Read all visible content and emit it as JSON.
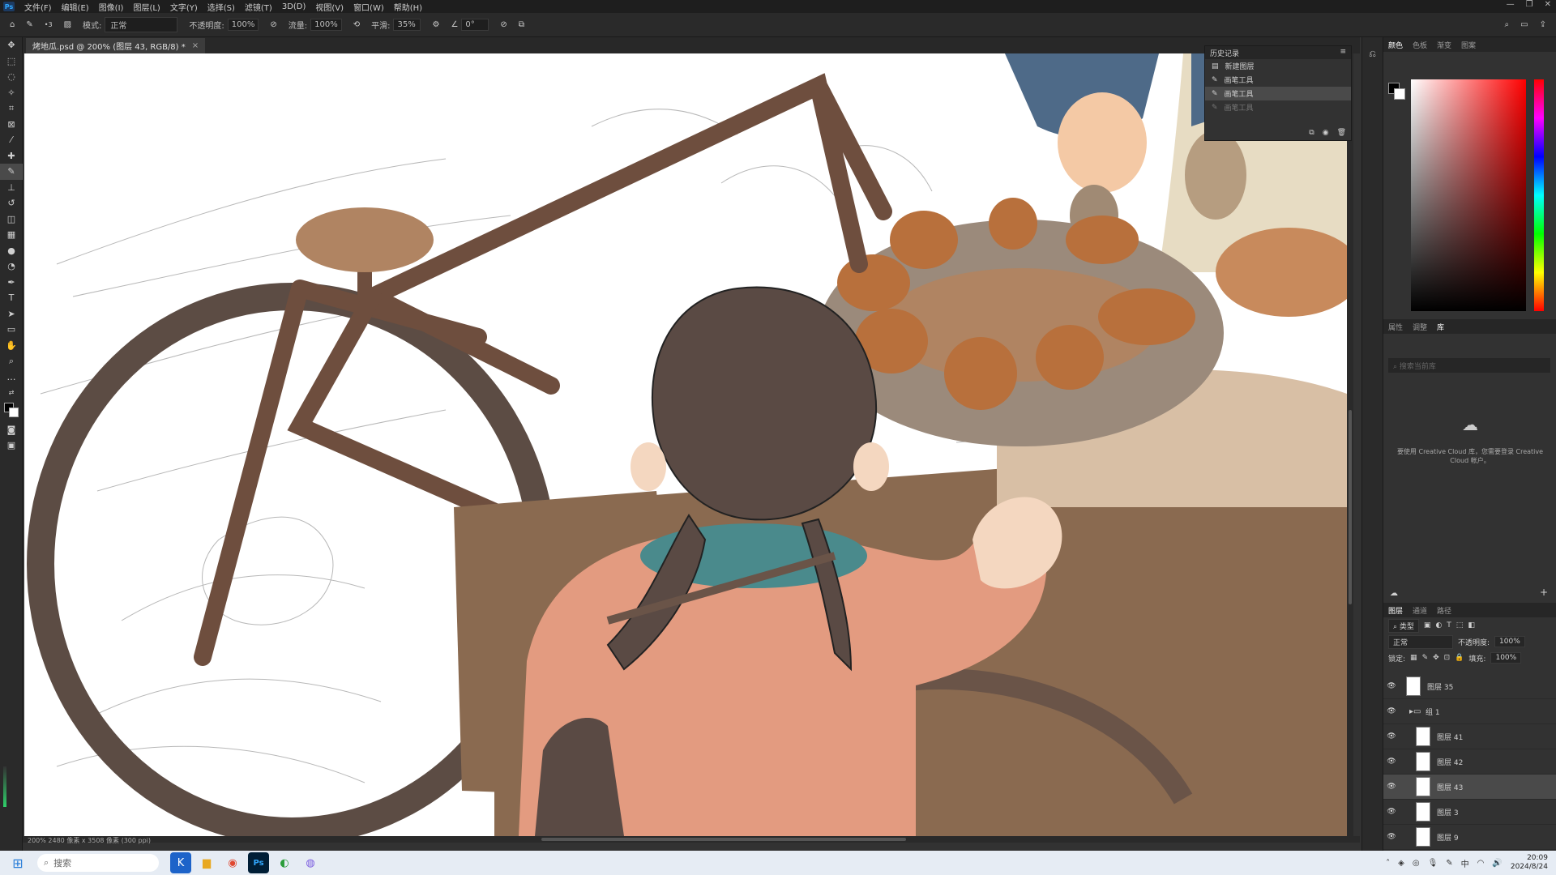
{
  "menubar": {
    "items": [
      "文件(F)",
      "编辑(E)",
      "图像(I)",
      "图层(L)",
      "文字(Y)",
      "选择(S)",
      "滤镜(T)",
      "3D(D)",
      "视图(V)",
      "窗口(W)",
      "帮助(H)"
    ]
  },
  "options": {
    "mode_label": "模式:",
    "mode_value": "正常",
    "opacity_label": "不透明度:",
    "opacity_value": "100%",
    "flow_label": "流量:",
    "flow_value": "100%",
    "smooth_label": "平滑:",
    "smooth_value": "35%",
    "angle_value": "0°",
    "brush_size": "3"
  },
  "document": {
    "tab_title": "烤地瓜.psd @ 200% (图层 43, RGB/8) *",
    "status": "200%   2480 像素 x 3508 像素 (300 ppi)"
  },
  "history": {
    "title": "历史记录",
    "items": [
      {
        "label": "新建图层"
      },
      {
        "label": "画笔工具"
      },
      {
        "label": "画笔工具"
      },
      {
        "label": "画笔工具"
      }
    ]
  },
  "color_panel": {
    "tabs": [
      "颜色",
      "色板",
      "渐变",
      "图案"
    ]
  },
  "props_panel": {
    "tabs": [
      "属性",
      "调整",
      "库"
    ],
    "search_placeholder": "搜索当前库",
    "message": "要使用 Creative Cloud 库，您需要登录 Creative Cloud 帐户。"
  },
  "layers_panel": {
    "tabs": [
      "图层",
      "通道",
      "路径"
    ],
    "filter_label": "类型",
    "blend_mode": "正常",
    "opacity_label": "不透明度:",
    "opacity_value": "100%",
    "lock_label": "锁定:",
    "fill_label": "填充:",
    "fill_value": "100%",
    "layers": [
      {
        "name": "图层 35",
        "type": "layer"
      },
      {
        "name": "组 1",
        "type": "group"
      },
      {
        "name": "图层 41",
        "type": "layer"
      },
      {
        "name": "图层 42",
        "type": "layer"
      },
      {
        "name": "图层 43",
        "type": "layer"
      },
      {
        "name": "图层 3",
        "type": "layer"
      },
      {
        "name": "图层 9",
        "type": "layer"
      }
    ]
  },
  "taskbar": {
    "search_placeholder": "搜索",
    "time": "20:09",
    "date": "2024/8/24"
  }
}
